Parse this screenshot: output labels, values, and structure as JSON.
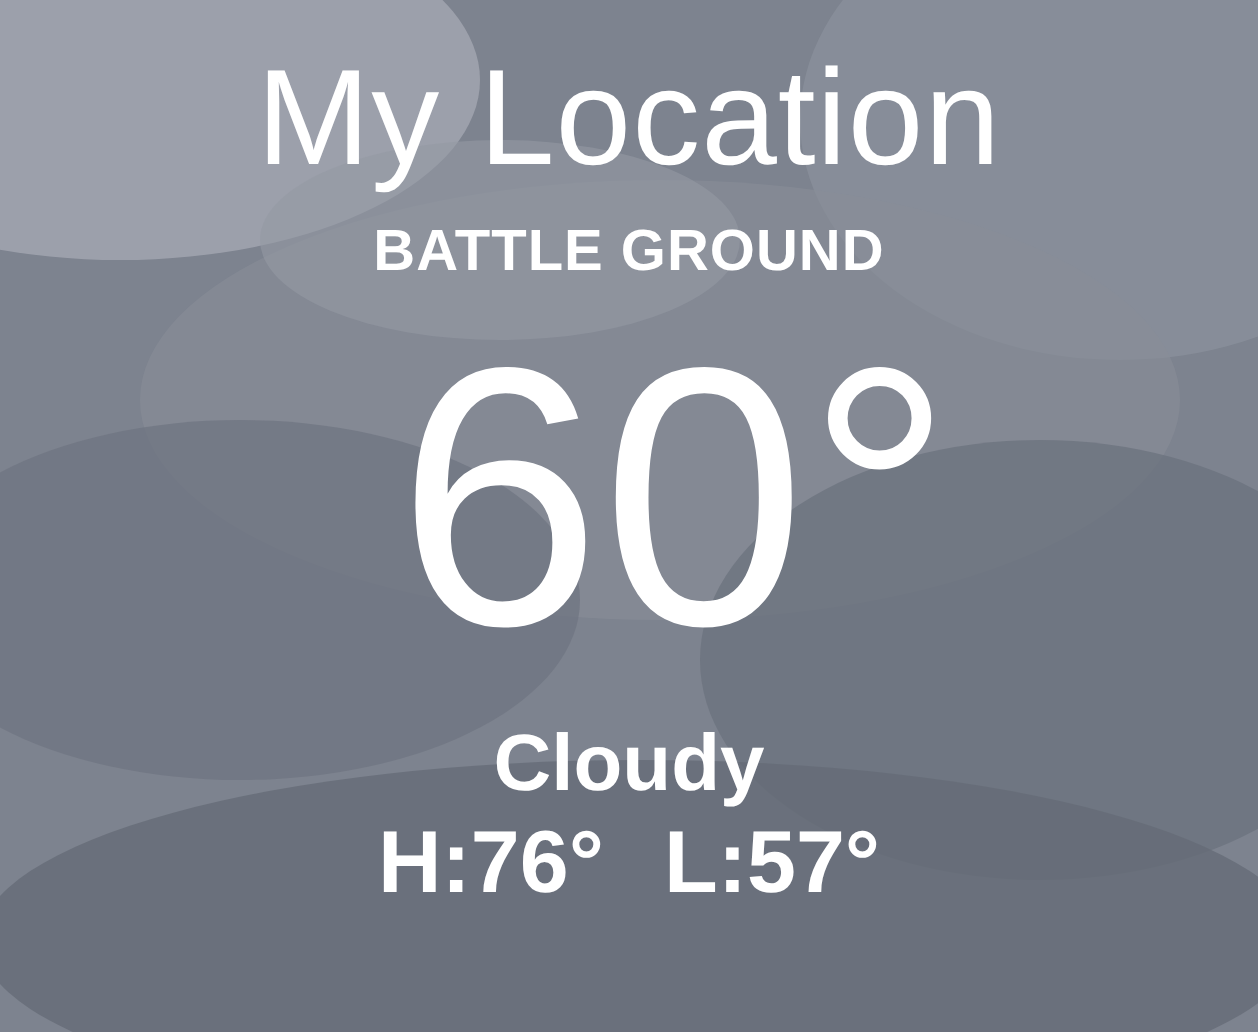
{
  "location": {
    "title": "My Location",
    "place": "BATTLE GROUND"
  },
  "current": {
    "temperature": "60°",
    "condition": "Cloudy",
    "high": "H:76°",
    "low": "L:57°"
  }
}
